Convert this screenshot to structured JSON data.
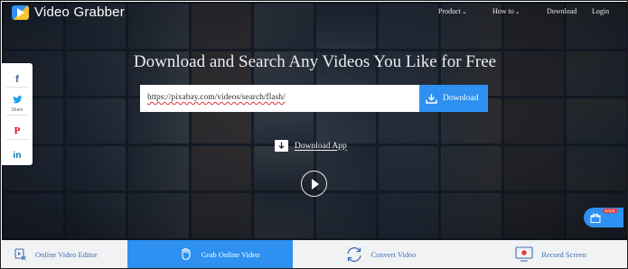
{
  "app": {
    "name": "Video Grabber"
  },
  "nav": {
    "items": [
      {
        "label": "Product",
        "has_dropdown": true
      },
      {
        "label": "How to",
        "has_dropdown": true
      },
      {
        "label": "Download",
        "has_dropdown": false
      },
      {
        "label": "Login",
        "has_dropdown": false
      }
    ],
    "chevron": "⌄"
  },
  "hero": {
    "headline": "Download and Search Any Videos You Like for Free",
    "search_value": "https://pixabay.com/videos/search/flash/",
    "download_button": "Download",
    "download_app": "Download App"
  },
  "share": {
    "items": [
      {
        "icon": "facebook-icon",
        "glyph": "f",
        "color": "#3b5998",
        "label": ""
      },
      {
        "icon": "twitter-icon",
        "glyph": "🐦",
        "color": "#1da1f2",
        "label": "Share"
      },
      {
        "icon": "pinterest-icon",
        "glyph": "P",
        "color": "#e60023",
        "label": ""
      },
      {
        "icon": "linkedin-icon",
        "glyph": "in",
        "color": "#0077b5",
        "label": ""
      }
    ]
  },
  "gift": {
    "badge": "SALE"
  },
  "tabs": [
    {
      "label": "Online Video Editor",
      "icon": "video-editor-icon",
      "active": false
    },
    {
      "label": "Grab Online Video",
      "icon": "grab-hand-icon",
      "active": true
    },
    {
      "label": "Convert Video",
      "icon": "convert-icon",
      "active": false
    },
    {
      "label": "Record Screen",
      "icon": "record-screen-icon",
      "active": false
    }
  ],
  "colors": {
    "accent": "#2e90f0",
    "tab_text": "#3f6fb0",
    "hero_bg": "#1b222c"
  }
}
